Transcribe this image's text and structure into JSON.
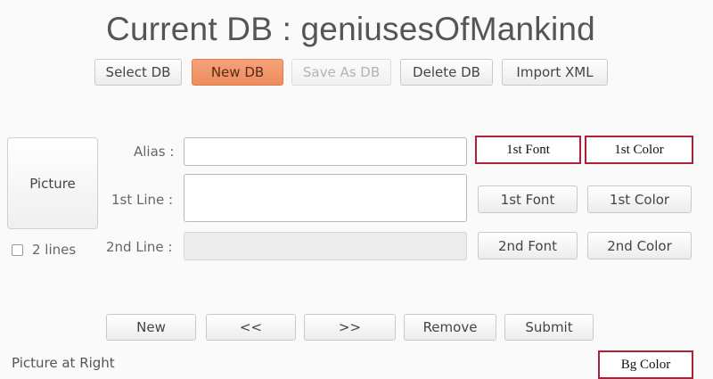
{
  "header": {
    "title": "Current DB : geniusesOfMankind"
  },
  "toolbar": {
    "select_db": "Select DB",
    "new_db": "New DB",
    "save_as_db": "Save As DB",
    "delete_db": "Delete DB",
    "import_xml": "Import XML"
  },
  "picture_button": "Picture",
  "two_lines": {
    "label": "2 lines",
    "checked": false
  },
  "form": {
    "alias": {
      "label": "Alias :",
      "value": "",
      "font_button": "1st Font",
      "color_button": "1st Color"
    },
    "first_line": {
      "label": "1st Line :",
      "value": "",
      "font_button": "1st Font",
      "color_button": "1st Color"
    },
    "second_line": {
      "label": "2nd Line :",
      "value": "",
      "font_button": "2nd Font",
      "color_button": "2nd Color"
    }
  },
  "nav": {
    "new": "New",
    "prev": "<<",
    "next": ">>",
    "remove": "Remove",
    "submit": "Submit"
  },
  "footer": {
    "picture_position": "Picture at Right",
    "bg_color_button": "Bg Color"
  },
  "colors": {
    "accent": "#ec8d5f",
    "highlight_border": "#b01f35"
  }
}
